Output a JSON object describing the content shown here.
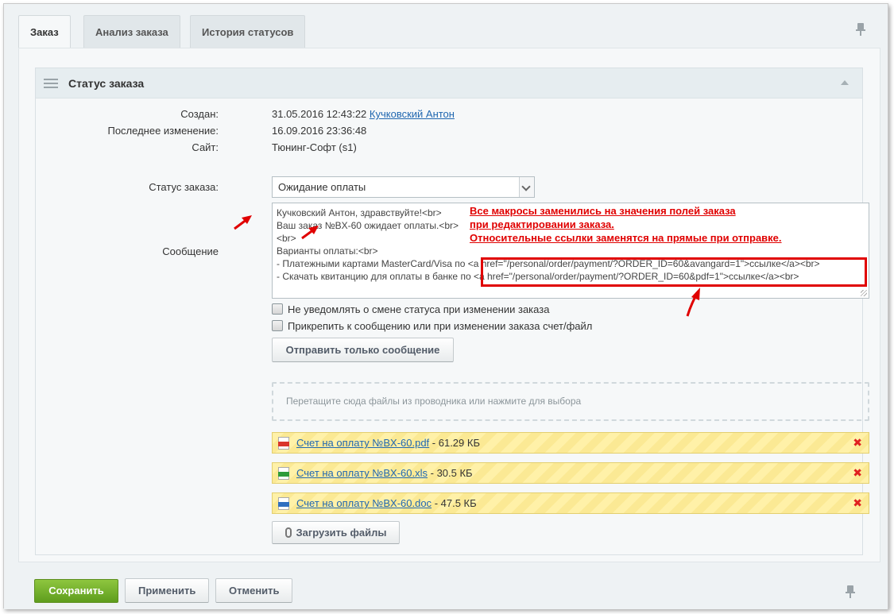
{
  "tabs": [
    {
      "label": "Заказ",
      "active": true
    },
    {
      "label": "Анализ заказа",
      "active": false
    },
    {
      "label": "История статусов",
      "active": false
    }
  ],
  "panel": {
    "title": "Статус заказа"
  },
  "fields": {
    "created_label": "Создан:",
    "created_date": "31.05.2016 12:43:22",
    "created_user": "Кучковский Антон",
    "modified_label": "Последнее изменение:",
    "modified_value": "16.09.2016 23:36:48",
    "site_label": "Сайт:",
    "site_value": "Тюнинг-Софт (s1)",
    "status_label": "Статус заказа:",
    "status_value": "Ожидание оплаты",
    "message_label": "Сообщение"
  },
  "message_lines": [
    "Кучковский Антон, здравствуйте!<br>",
    "Ваш заказ №BX-60 ожидает оплаты.<br>",
    "<br>",
    "Варианты оплаты:<br>",
    "- Платежными картами MasterCard/Visa по <a href=\"/personal/order/payment/?ORDER_ID=60&avangard=1\">ссылке</a><br>",
    "- Скачать квитанцию для оплаты в банке по <a href=\"/personal/order/payment/?ORDER_ID=60&pdf=1\">ссылке</a><br>"
  ],
  "annotation": {
    "line1": "Все макросы заменились на значения полей заказа",
    "line2": "при редактировании заказа.",
    "line3": "Относительные ссылки заменятся на прямые при отправке."
  },
  "checkboxes": {
    "no_notify": "Не уведомлять о смене статуса при изменении заказа",
    "attach_invoice": "Прикрепить к сообщению или при изменении заказа счет/файл"
  },
  "send_only_button": "Отправить только сообщение",
  "dropzone_text": "Перетащите сюда файлы из проводника или нажмите для выбора",
  "files": [
    {
      "name": "Счет на оплату №BX-60.pdf",
      "size": "- 61.29 КБ",
      "icon": "pdf-file-icon",
      "color": "#d9342b"
    },
    {
      "name": "Счет на оплату №BX-60.xls",
      "size": "- 30.5 КБ",
      "icon": "xls-file-icon",
      "color": "#2e9b3a"
    },
    {
      "name": "Счет на оплату №BX-60.doc",
      "size": "- 47.5 КБ",
      "icon": "doc-file-icon",
      "color": "#2f6fc0"
    }
  ],
  "upload_button": "Загрузить файлы",
  "footer": {
    "save": "Сохранить",
    "apply": "Применить",
    "cancel": "Отменить"
  }
}
